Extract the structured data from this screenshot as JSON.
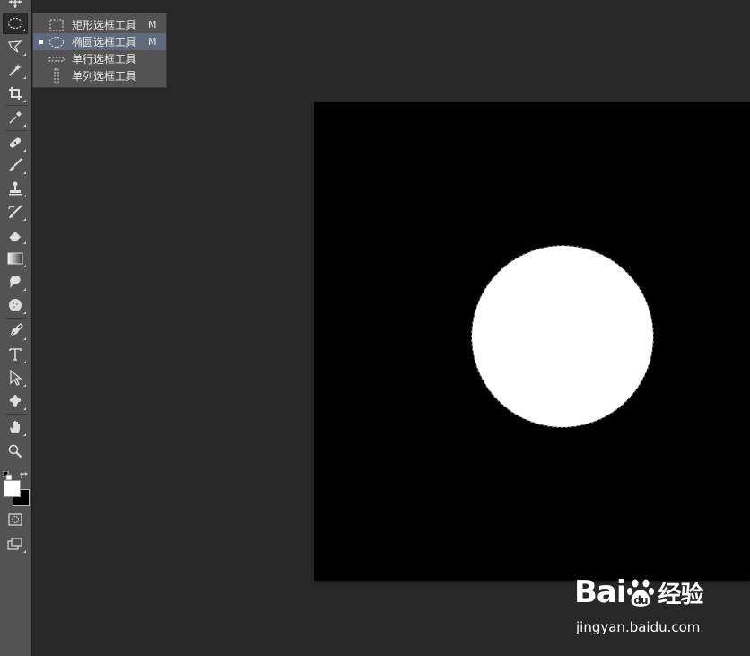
{
  "flyout": {
    "items": [
      {
        "label": "矩形选框工具",
        "key": "M",
        "icon": "rect-marquee-icon",
        "selected": false
      },
      {
        "label": "椭圆选框工具",
        "key": "M",
        "icon": "ellipse-marquee-icon",
        "selected": true
      },
      {
        "label": "单行选框工具",
        "key": "",
        "icon": "single-row-marquee-icon",
        "selected": false
      },
      {
        "label": "单列选框工具",
        "key": "",
        "icon": "single-column-marquee-icon",
        "selected": false
      }
    ]
  },
  "colors": {
    "foreground": "#ffffff",
    "background": "#000000",
    "workspace": "#282828",
    "toolbar": "#535353",
    "selection_highlight": "#5f6a7c"
  },
  "tools": [
    "move-icon",
    "ellipse-marquee-icon",
    "lasso-icon",
    "magic-wand-icon",
    "crop-icon",
    "eyedropper-icon",
    "healing-brush-icon",
    "brush-icon",
    "clone-stamp-icon",
    "history-brush-icon",
    "eraser-icon",
    "gradient-icon",
    "blur-icon",
    "dodge-icon",
    "pen-icon",
    "type-icon",
    "path-selection-icon",
    "custom-shape-icon",
    "hand-icon",
    "zoom-icon",
    "quick-mask-icon",
    "screen-mode-icon"
  ],
  "watermark": {
    "logo_text_1": "Bai",
    "logo_text_2": "du",
    "logo_text_3": "经验",
    "url": "jingyan.baidu.com"
  }
}
